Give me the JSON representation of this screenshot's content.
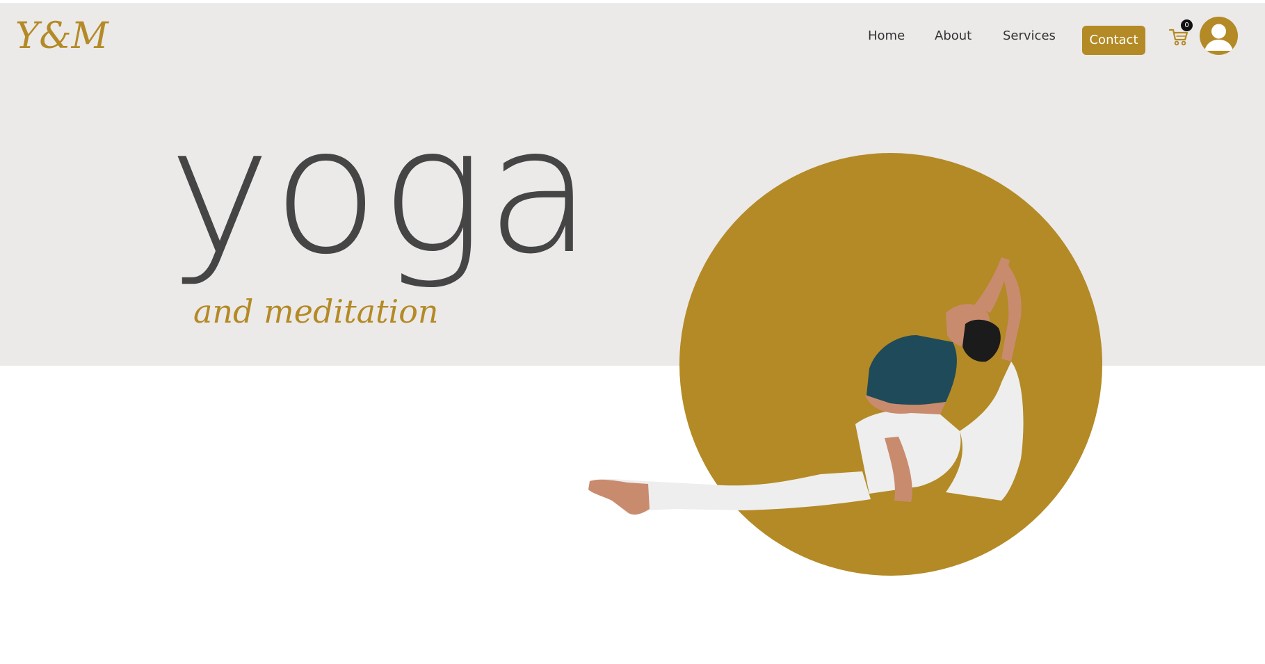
{
  "header": {
    "logo_text": "Y&M",
    "nav": {
      "home": "Home",
      "about": "About",
      "services": "Services"
    },
    "contact_label": "Contact",
    "cart_count": "0",
    "cart_icon": "cart-icon",
    "avatar_icon": "user-avatar-icon"
  },
  "hero": {
    "title": "yoga",
    "subtitle": "and meditation",
    "image": "woman-yoga-pose-in-gold-circle"
  },
  "colors": {
    "accent": "#b38a25",
    "band": "#ece9e9",
    "title": "#454545",
    "background": "#ffffff"
  }
}
